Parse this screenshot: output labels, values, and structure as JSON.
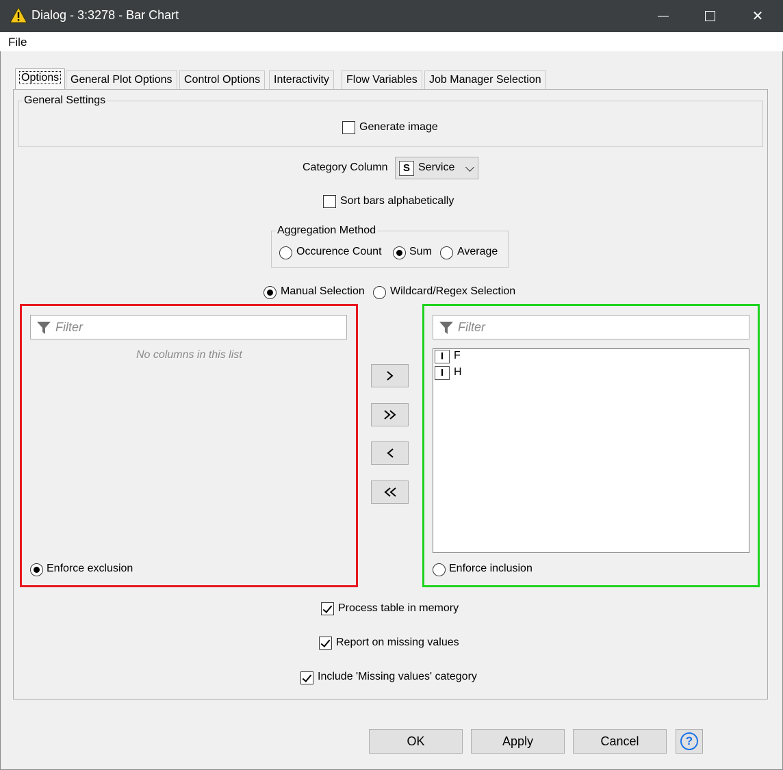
{
  "window": {
    "title": "Dialog - 3:3278 - Bar Chart",
    "minimize_glyph": "—",
    "maximize_glyph": "☐",
    "close_glyph": "✕"
  },
  "menu": {
    "file": "File"
  },
  "tabs": [
    {
      "label": "Options",
      "active": true
    },
    {
      "label": "General Plot Options"
    },
    {
      "label": "Control Options"
    },
    {
      "label": "Interactivity"
    },
    {
      "label": "Flow Variables"
    },
    {
      "label": "Job Manager Selection"
    }
  ],
  "general_settings": {
    "legend": "General Settings",
    "generate_image": {
      "label": "Generate image",
      "checked": false
    }
  },
  "category_column": {
    "label": "Category Column",
    "type_badge": "S",
    "value": "Service"
  },
  "sort_bars": {
    "label": "Sort bars alphabetically",
    "checked": false
  },
  "aggregation": {
    "legend": "Aggregation Method",
    "options": [
      {
        "label": "Occurence Count",
        "selected": false
      },
      {
        "label": "Sum",
        "selected": true
      },
      {
        "label": "Average",
        "selected": false
      }
    ]
  },
  "selection_mode": {
    "options": [
      {
        "label": "Manual Selection",
        "selected": true
      },
      {
        "label": "Wildcard/Regex Selection",
        "selected": false
      }
    ]
  },
  "exclude_panel": {
    "filter_placeholder": "Filter",
    "empty_text": "No columns in this list",
    "enforce_label": "Enforce exclusion",
    "enforce_selected": true,
    "border_color": "#e8171f"
  },
  "include_panel": {
    "filter_placeholder": "Filter",
    "items": [
      {
        "type": "I",
        "name": "F"
      },
      {
        "type": "I",
        "name": "H"
      }
    ],
    "enforce_label": "Enforce inclusion",
    "enforce_selected": false,
    "border_color": "#1ed31e"
  },
  "move_buttons": [
    {
      "glyph": "›",
      "name": "add"
    },
    {
      "glyph": "»",
      "name": "add-all"
    },
    {
      "glyph": "‹",
      "name": "remove"
    },
    {
      "glyph": "«",
      "name": "remove-all"
    }
  ],
  "options_bottom": {
    "process_in_memory": {
      "label": "Process table in memory",
      "checked": true
    },
    "report_missing": {
      "label": "Report on missing values",
      "checked": true
    },
    "include_missing_category": {
      "label": "Include 'Missing values' category",
      "checked": true
    }
  },
  "buttons": {
    "ok": "OK",
    "apply": "Apply",
    "cancel": "Cancel",
    "help": "?"
  },
  "colors": {
    "titlebar": "#3c3f41",
    "warning_icon": "#f5c518",
    "help_icon": "#1a73e8"
  }
}
